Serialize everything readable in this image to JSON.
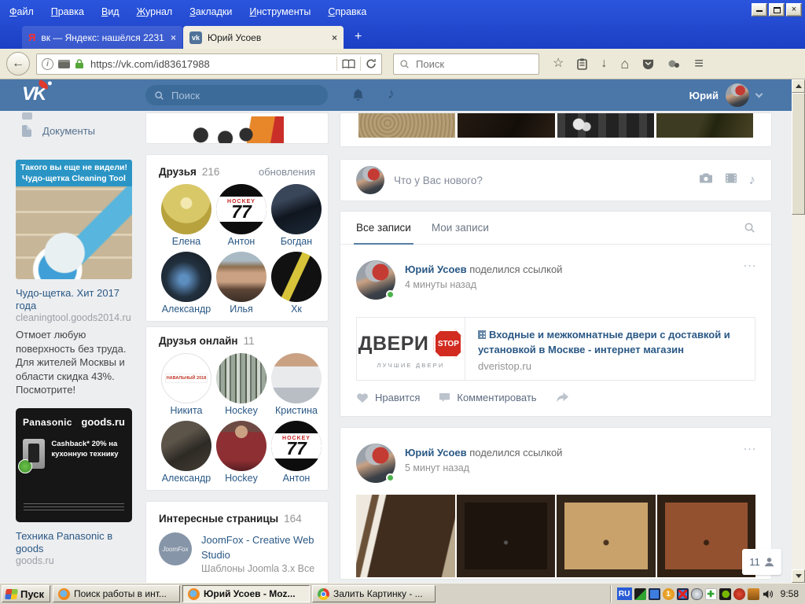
{
  "browser": {
    "menu_items": [
      "Файл",
      "Правка",
      "Вид",
      "Журнал",
      "Закладки",
      "Инструменты",
      "Справка"
    ],
    "tabs": [
      {
        "favicon": "Я",
        "title": "вк — Яндекс: нашёлся 2231..."
      },
      {
        "favicon": "vk",
        "title": "Юрий Усоев"
      }
    ],
    "url": "https://vk.com/id83617988",
    "search_placeholder": "Поиск"
  },
  "vk": {
    "header": {
      "logo": "VK",
      "search_placeholder": "Поиск",
      "user_name": "Юрий"
    },
    "nav": {
      "documents": "Документы"
    },
    "ads": [
      {
        "banner_line1": "Такого вы еще не видели!",
        "banner_line2": "Чудо-щетка Cleaning Tool",
        "title": "Чудо-щетка. Хит 2017 года",
        "link": "cleaningtool.goods2014.ru",
        "text": "Отмоет любую поверхность без труда. Для жителей Москвы и области скидка 43%. Посмотрите!"
      },
      {
        "brand_left": "Panasonic",
        "brand_right": "goods.ru",
        "offer": "Cashback* 20% на кухонную технику",
        "title": "Техника Panasonic в goods",
        "link": "goods.ru"
      }
    ],
    "friends": {
      "title": "Друзья",
      "count": "216",
      "updates_link": "обновления",
      "items": [
        {
          "name": "Елена"
        },
        {
          "name": "Антон",
          "badge_top": "HOCKEY",
          "badge_num": "77"
        },
        {
          "name": "Богдан"
        },
        {
          "name": "Александр"
        },
        {
          "name": "Илья"
        },
        {
          "name": "Хк"
        }
      ]
    },
    "friends_online": {
      "title": "Друзья онлайн",
      "count": "11",
      "items": [
        {
          "name": "Никита",
          "logo_text": "НАВАЛЬНЫЙ 2018"
        },
        {
          "name": "Hockey"
        },
        {
          "name": "Кристина"
        },
        {
          "name": "Александр"
        },
        {
          "name": "Hockey"
        },
        {
          "name": "Антон",
          "badge_top": "HOCKEY",
          "badge_num": "77"
        }
      ]
    },
    "pages": {
      "title": "Интересные страницы",
      "count": "164",
      "items": [
        {
          "logo": "JoomFox",
          "name": "JoomFox - Creative Web Studio",
          "desc": "Шаблоны Joomla 3.x Все"
        }
      ]
    },
    "composer": {
      "placeholder": "Что у Вас нового?"
    },
    "wall_tabs": {
      "all": "Все записи",
      "my": "Мои записи"
    },
    "posts": [
      {
        "author": "Юрий Усоев",
        "action": "поделился ссылкой",
        "time": "4 минуты назад",
        "link_card": {
          "logo_word": "ДВЕРИ",
          "logo_stop": "STOP",
          "logo_tagline": "ЛУЧШИЕ ДВЕРИ",
          "title_line1": "Входные и межкомнатные двери с доставкой и",
          "title_line2": "установкой в Москве - интернет магазин",
          "domain": "dveristop.ru"
        },
        "like_label": "Нравится",
        "comment_label": "Комментировать"
      },
      {
        "author": "Юрий Усоев",
        "action": "поделился ссылкой",
        "time": "5 минут назад"
      }
    ],
    "online_widget": {
      "count": "11"
    }
  },
  "taskbar": {
    "start_label": "Пуск",
    "tasks": [
      {
        "title": "Поиск работы в инт..."
      },
      {
        "title": "Юрий Усоев - Moz..."
      },
      {
        "title": "Залить Картинку - ..."
      }
    ],
    "tray_lang": "RU",
    "tray_badge": "1",
    "clock": "9:58"
  },
  "icons": {
    "close": "×",
    "plus": "+",
    "back": "←",
    "down": "↓",
    "star": "☆",
    "home": "⌂",
    "menu": "≡",
    "music": "♪",
    "ellipsis": "...",
    "info": "i"
  },
  "colors": {
    "vk_blue": "#4a76a8",
    "link_blue": "#2a5885",
    "titlebar_blue": "#2149cf",
    "lock_green": "#57a639"
  }
}
